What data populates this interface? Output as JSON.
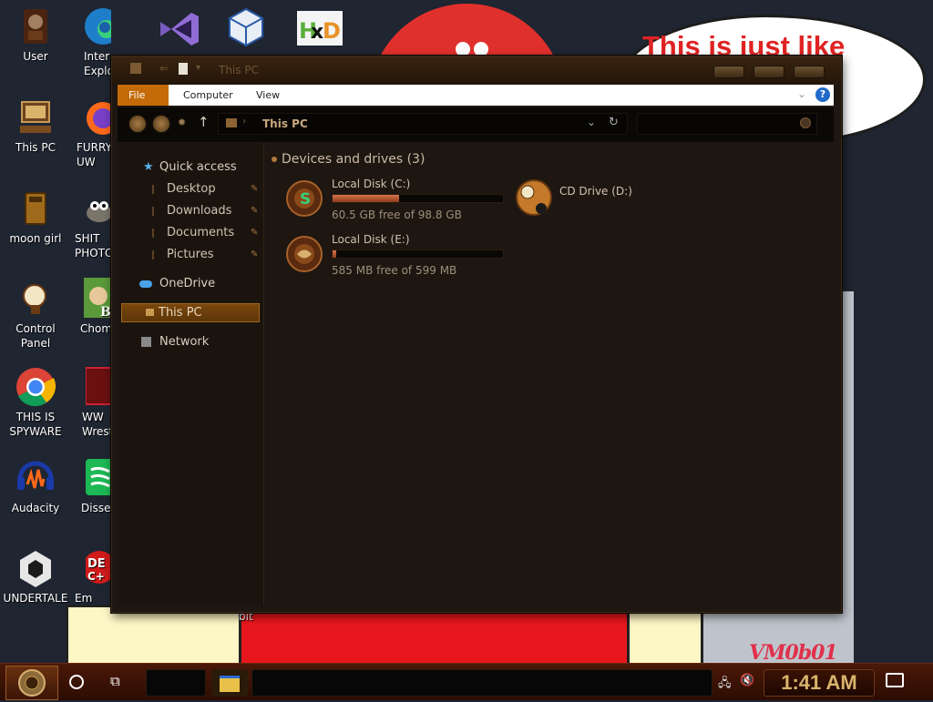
{
  "desktop": {
    "speech_text": "This is just like\n's",
    "signature": "VM0b01",
    "icons": [
      {
        "label": "User"
      },
      {
        "label": "Inter\nExplo"
      },
      {
        "label": "This PC"
      },
      {
        "label": "FURRY\nUW"
      },
      {
        "label": "moon girl"
      },
      {
        "label": "SHIT\nPHOTO"
      },
      {
        "label": "Control Panel"
      },
      {
        "label": "Chomik"
      },
      {
        "label": "THIS IS\nSPYWARE"
      },
      {
        "label": "WW\nWrest"
      },
      {
        "label": "Audacity"
      },
      {
        "label": "Disser"
      },
      {
        "label": "UNDERTALE"
      },
      {
        "label": "Em"
      },
      {
        "label": "bit"
      }
    ]
  },
  "window": {
    "title": "This PC",
    "ribbon_tabs": [
      "File",
      "Computer",
      "View"
    ],
    "address": "This PC"
  },
  "sidebar": {
    "quick_access": "Quick access",
    "items": [
      "Desktop",
      "Downloads",
      "Documents",
      "Pictures"
    ],
    "onedrive": "OneDrive",
    "thispc": "This PC",
    "network": "Network"
  },
  "content": {
    "group_header": "Devices and drives (3)",
    "drives": [
      {
        "name": "Local Disk (C:)",
        "free": "60.5 GB free of 98.8 GB",
        "used_fraction": 0.39
      },
      {
        "name": "Local Disk (E:)",
        "free": "585 MB free of 599 MB",
        "used_fraction": 0.02
      },
      {
        "name": "CD Drive (D:)"
      }
    ]
  },
  "taskbar": {
    "clock": "1:41 AM"
  },
  "colors": {
    "accent": "#c56a08",
    "window_bg": "#1e1610",
    "taskbar": "#3b1205"
  }
}
